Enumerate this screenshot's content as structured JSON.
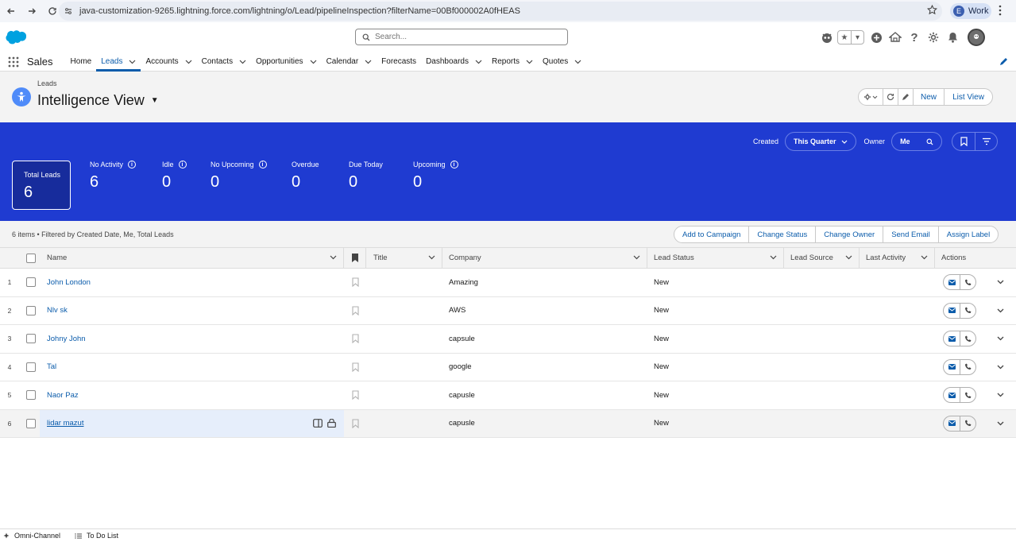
{
  "browser": {
    "url": "java-customization-9265.lightning.force.com/lightning/o/Lead/pipelineInspection?filterName=00Bf000002A0fHEAS",
    "profile_initial": "E",
    "profile_label": "Work"
  },
  "header": {
    "search_placeholder": "Search..."
  },
  "app_nav": {
    "app_name": "Sales",
    "items": [
      {
        "label": "Home",
        "dropdown": false,
        "active": false
      },
      {
        "label": "Leads",
        "dropdown": true,
        "active": true
      },
      {
        "label": "Accounts",
        "dropdown": true,
        "active": false
      },
      {
        "label": "Contacts",
        "dropdown": true,
        "active": false
      },
      {
        "label": "Opportunities",
        "dropdown": true,
        "active": false
      },
      {
        "label": "Calendar",
        "dropdown": true,
        "active": false
      },
      {
        "label": "Forecasts",
        "dropdown": false,
        "active": false
      },
      {
        "label": "Dashboards",
        "dropdown": true,
        "active": false
      },
      {
        "label": "Reports",
        "dropdown": true,
        "active": false
      },
      {
        "label": "Quotes",
        "dropdown": true,
        "active": false
      }
    ]
  },
  "page_header": {
    "object_label": "Leads",
    "title": "Intelligence View",
    "buttons": {
      "new": "New",
      "list_view": "List View"
    }
  },
  "filters": {
    "created_label": "Created",
    "created_value": "This Quarter",
    "owner_label": "Owner",
    "owner_value": "Me"
  },
  "metrics": [
    {
      "label": "Total Leads",
      "value": "6",
      "info": false,
      "selected": true
    },
    {
      "label": "No Activity",
      "value": "6",
      "info": true,
      "selected": false
    },
    {
      "label": "Idle",
      "value": "0",
      "info": true,
      "selected": false
    },
    {
      "label": "No Upcoming",
      "value": "0",
      "info": true,
      "selected": false
    },
    {
      "label": "Overdue",
      "value": "0",
      "info": false,
      "selected": false
    },
    {
      "label": "Due Today",
      "value": "0",
      "info": false,
      "selected": false
    },
    {
      "label": "Upcoming",
      "value": "0",
      "info": true,
      "selected": false
    }
  ],
  "list": {
    "info": "6 items • Filtered by Created Date, Me, Total Leads",
    "bulk_actions": [
      "Add to Campaign",
      "Change Status",
      "Change Owner",
      "Send Email",
      "Assign Label"
    ],
    "columns": {
      "name": "Name",
      "title": "Title",
      "company": "Company",
      "lead_status": "Lead Status",
      "lead_source": "Lead Source",
      "last_activity": "Last Activity",
      "actions": "Actions"
    },
    "rows": [
      {
        "num": "1",
        "name": "John London",
        "title": "",
        "company": "Amazing",
        "status": "New",
        "source": "",
        "activity": ""
      },
      {
        "num": "2",
        "name": "Nlv sk",
        "title": "",
        "company": "AWS",
        "status": "New",
        "source": "",
        "activity": ""
      },
      {
        "num": "3",
        "name": "Johny John",
        "title": "",
        "company": "capsule",
        "status": "New",
        "source": "",
        "activity": ""
      },
      {
        "num": "4",
        "name": "Tal",
        "title": "",
        "company": "google",
        "status": "New",
        "source": "",
        "activity": ""
      },
      {
        "num": "5",
        "name": "Naor Paz",
        "title": "",
        "company": "capusle",
        "status": "New",
        "source": "",
        "activity": ""
      },
      {
        "num": "6",
        "name": "lidar mazut",
        "title": "",
        "company": "capusle",
        "status": "New",
        "source": "",
        "activity": ""
      }
    ]
  },
  "utility_bar": {
    "omni_channel": "Omni-Channel",
    "todo": "To Do List"
  },
  "colors": {
    "brand_blue": "#0b5cab",
    "metrics_band": "#1f3bd1",
    "salesforce_cloud": "#00a1e0"
  }
}
